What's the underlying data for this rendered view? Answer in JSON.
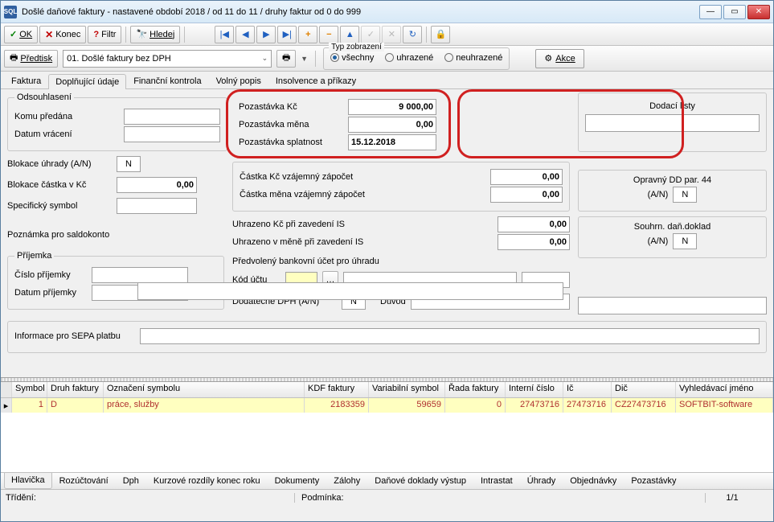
{
  "window": {
    "title": "Došlé daňové faktury - nastavené období 2018 / od 11 do 11 / druhy faktur od 0 do 999"
  },
  "toolbar": {
    "ok": "OK",
    "konec": "Konec",
    "filtr": "Filtr",
    "hledej": "Hledej",
    "predtisk": "Předtisk",
    "predtisk_select": "01. Došlé faktury bez DPH",
    "typ_zobrazeni": "Typ zobrazení",
    "r_vsechny": "všechny",
    "r_uhrazene": "uhrazené",
    "r_neuhrazene": "neuhrazené",
    "akce": "Akce"
  },
  "tabs1": [
    "Faktura",
    "Doplňující údaje",
    "Finanční kontrola",
    "Volný popis",
    "Insolvence a příkazy"
  ],
  "form": {
    "odsouhlaseni": "Odsouhlasení",
    "komu_predana": "Komu předána",
    "datum_vraceni": "Datum vrácení",
    "blokace_uhrady": "Blokace úhrady (A/N)",
    "blokace_uhrady_v": "N",
    "blokace_castka": "Blokace částka v Kč",
    "blokace_castka_v": "0,00",
    "specificky": "Specifický symbol",
    "poznamka_saldo": "Poznámka pro saldokonto",
    "prijemka": "Příjemka",
    "cislo_prijemky": "Číslo příjemky",
    "datum_prijemky": "Datum příjemky",
    "pozastavka_kc": "Pozastávka Kč",
    "pozastavka_kc_v": "9 000,00",
    "pozastavka_mena": "Pozastávka měna",
    "pozastavka_mena_v": "0,00",
    "pozastavka_spl": "Pozastávka splatnost",
    "pozastavka_spl_v": "15.12.2018",
    "castka_kc_zap": "Částka Kč vzájemný zápočet",
    "castka_kc_zap_v": "0,00",
    "castka_mena_zap": "Částka měna vzájemný zápočet",
    "castka_mena_zap_v": "0,00",
    "uhrazeno_kc": "Uhrazeno Kč při zavedení IS",
    "uhrazeno_kc_v": "0,00",
    "uhrazeno_mena": "Uhrazeno v měně při zavedení IS",
    "uhrazeno_mena_v": "0,00",
    "predvoleny_ucet": "Předvolený bankovní účet pro úhradu",
    "kod_uctu": "Kód účtu",
    "dodatecne_dph": "Dodatečné DPH (A/N)",
    "dodatecne_dph_v": "N",
    "duvod": "Důvod",
    "info_sepa": "Informace pro SEPA platbu",
    "dodaci_listy": "Dodací listy",
    "opravny_dd": "Opravný DD par. 44",
    "opravny_an": "(A/N)",
    "opravny_v": "N",
    "souhrn": "Souhrn. daň.doklad",
    "souhrn_an": "(A/N)",
    "souhrn_v": "N"
  },
  "grid": {
    "headers": [
      "Symbol",
      "Druh faktury",
      "Označení symbolu",
      "KDF faktury",
      "Variabilní symbol",
      "Řada faktury",
      "Interní číslo",
      "Ič",
      "Dič",
      "Vyhledávací jméno"
    ],
    "row": [
      "1",
      "D",
      "práce, služby",
      "2183359",
      "59659",
      "0",
      "27473716",
      "27473716",
      "CZ27473716",
      "SOFTBIT-software"
    ]
  },
  "tabs2": [
    "Hlavička",
    "Rozúčtování",
    "Dph",
    "Kurzové rozdíly konec roku",
    "Dokumenty",
    "Zálohy",
    "Daňové doklady výstup",
    "Intrastat",
    "Úhrady",
    "Objednávky",
    "Pozastávky"
  ],
  "status": {
    "trideni": "Třídění:",
    "podminka": "Podmínka:",
    "page": "1/1"
  }
}
